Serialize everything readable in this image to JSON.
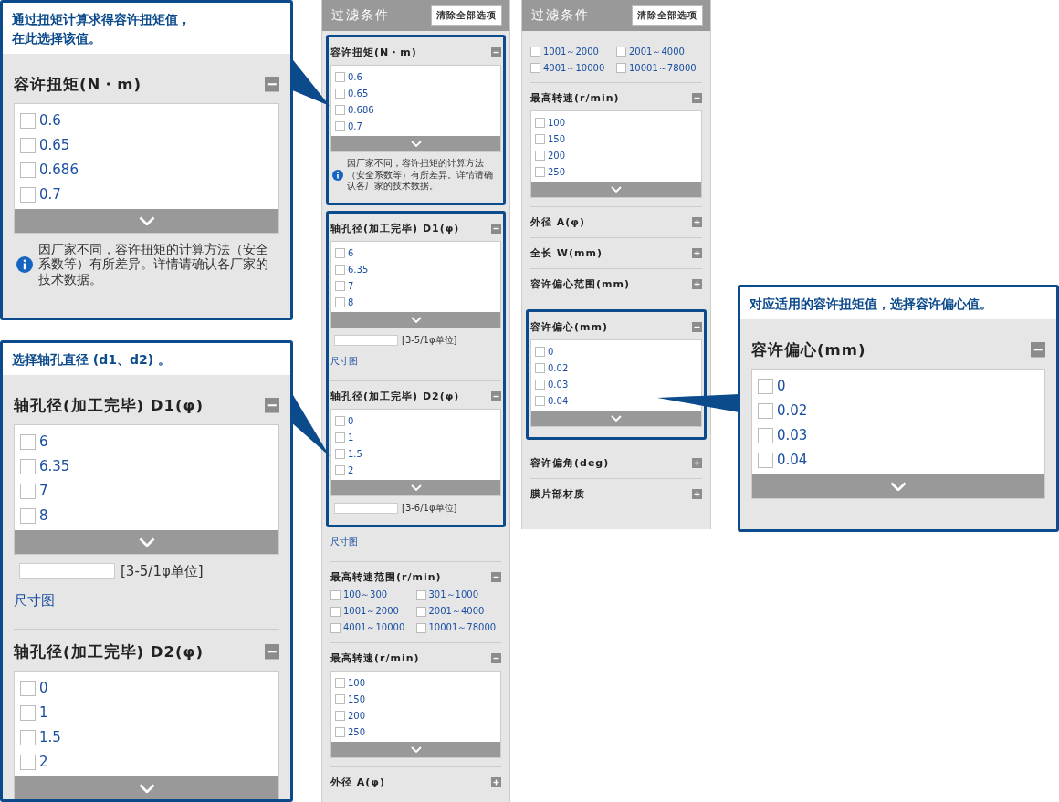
{
  "callouts": [
    {
      "caption": [
        "通过扭矩计算求得容许扭矩值，",
        "在此选择该值。"
      ],
      "groups": [
        {
          "sections": [
            {
              "kind": "list",
              "title": "容许扭矩(N・m)",
              "expanded": true,
              "items": [
                {
                  "label": "0.6",
                  "checked": false
                },
                {
                  "label": "0.65",
                  "checked": false
                },
                {
                  "label": "0.686",
                  "checked": false
                },
                {
                  "label": "0.7",
                  "checked": false
                }
              ],
              "note": "因厂家不同，容许扭矩的计算方法（安全系数等）有所差异。详情请确认各厂家的技术数据。"
            }
          ]
        }
      ]
    },
    {
      "caption": [
        "选择轴孔直径 (d1、d2) 。"
      ],
      "groups": [
        {
          "sections": [
            {
              "kind": "list",
              "title": "轴孔径(加工完毕) D1(φ)",
              "expanded": true,
              "items": [
                {
                  "label": "6",
                  "checked": false
                },
                {
                  "label": "6.35",
                  "checked": false
                },
                {
                  "label": "7",
                  "checked": false
                },
                {
                  "label": "8",
                  "checked": false
                }
              ],
              "range": "[3-5/1φ单位]"
            },
            {
              "kind": "link",
              "label": "尺寸图"
            },
            {
              "kind": "list",
              "title": "轴孔径(加工完毕) D2(φ)",
              "expanded": true,
              "items": [
                {
                  "label": "0",
                  "checked": false
                },
                {
                  "label": "1",
                  "checked": false
                },
                {
                  "label": "1.5",
                  "checked": false
                },
                {
                  "label": "2",
                  "checked": false
                }
              ]
            }
          ]
        }
      ]
    },
    {
      "caption": [
        "对应适用的容许扭矩值，选择容许偏心值。"
      ],
      "groups": [
        {
          "sections": [
            {
              "kind": "list",
              "title": "容许偏心(mm)",
              "expanded": true,
              "items": [
                {
                  "label": "0",
                  "checked": false
                },
                {
                  "label": "0.02",
                  "checked": false
                },
                {
                  "label": "0.03",
                  "checked": false
                },
                {
                  "label": "0.04",
                  "checked": false
                }
              ]
            }
          ]
        }
      ]
    }
  ],
  "panels": [
    {
      "title": "过滤条件",
      "clear_button": "清除全部选项",
      "groups": [
        {
          "highlighted": true,
          "sections": [
            {
              "kind": "list",
              "title": "容许扭矩(N・m)",
              "expanded": true,
              "items": [
                {
                  "label": "0.6",
                  "checked": false
                },
                {
                  "label": "0.65",
                  "checked": false
                },
                {
                  "label": "0.686",
                  "checked": false
                },
                {
                  "label": "0.7",
                  "checked": false
                }
              ],
              "note": "因厂家不同，容许扭矩的计算方法（安全系数等）有所差异。详情请确认各厂家的技术数据。"
            }
          ]
        },
        {
          "highlighted": true,
          "sections": [
            {
              "kind": "list",
              "title": "轴孔径(加工完毕) D1(φ)",
              "expanded": true,
              "items": [
                {
                  "label": "6",
                  "checked": false
                },
                {
                  "label": "6.35",
                  "checked": false
                },
                {
                  "label": "7",
                  "checked": false
                },
                {
                  "label": "8",
                  "checked": false
                }
              ],
              "range": "[3-5/1φ单位]"
            },
            {
              "kind": "link",
              "label": "尺寸图"
            },
            {
              "kind": "list",
              "title": "轴孔径(加工完毕) D2(φ)",
              "expanded": true,
              "items": [
                {
                  "label": "0",
                  "checked": false
                },
                {
                  "label": "1",
                  "checked": false
                },
                {
                  "label": "1.5",
                  "checked": false
                },
                {
                  "label": "2",
                  "checked": false
                }
              ],
              "range": "[3-6/1φ单位]"
            }
          ]
        },
        {
          "highlighted": false,
          "sections": [
            {
              "kind": "link",
              "label": "尺寸图"
            },
            {
              "kind": "grid",
              "title": "最高转速范围(r/min)",
              "expanded": true,
              "items": [
                {
                  "label": "100～300",
                  "checked": false
                },
                {
                  "label": "301～1000",
                  "checked": false
                },
                {
                  "label": "1001～2000",
                  "checked": false
                },
                {
                  "label": "2001～4000",
                  "checked": false
                },
                {
                  "label": "4001～10000",
                  "checked": false
                },
                {
                  "label": "10001～78000",
                  "checked": false
                }
              ]
            },
            {
              "kind": "list",
              "title": "最高转速(r/min)",
              "expanded": true,
              "items": [
                {
                  "label": "100",
                  "checked": false
                },
                {
                  "label": "150",
                  "checked": false
                },
                {
                  "label": "200",
                  "checked": false
                },
                {
                  "label": "250",
                  "checked": false
                }
              ]
            },
            {
              "kind": "list",
              "title": "外径 A(φ)",
              "expanded": false
            }
          ]
        }
      ]
    },
    {
      "title": "过滤条件",
      "clear_button": "清除全部选项",
      "groups": [
        {
          "highlighted": false,
          "sections": [
            {
              "kind": "grid",
              "items": [
                {
                  "label": "1001～2000",
                  "checked": false
                },
                {
                  "label": "2001～4000",
                  "checked": false
                },
                {
                  "label": "4001～10000",
                  "checked": false
                },
                {
                  "label": "10001～78000",
                  "checked": false
                }
              ]
            },
            {
              "kind": "list",
              "title": "最高转速(r/min)",
              "expanded": true,
              "items": [
                {
                  "label": "100",
                  "checked": false
                },
                {
                  "label": "150",
                  "checked": false
                },
                {
                  "label": "200",
                  "checked": false
                },
                {
                  "label": "250",
                  "checked": false
                }
              ]
            },
            {
              "kind": "list",
              "title": "外径 A(φ)",
              "expanded": false
            },
            {
              "kind": "list",
              "title": "全长 W(mm)",
              "expanded": false
            },
            {
              "kind": "list",
              "title": "容许偏心范围(mm)",
              "expanded": false
            }
          ]
        },
        {
          "highlighted": true,
          "sections": [
            {
              "kind": "list",
              "title": "容许偏心(mm)",
              "expanded": true,
              "items": [
                {
                  "label": "0",
                  "checked": false
                },
                {
                  "label": "0.02",
                  "checked": false
                },
                {
                  "label": "0.03",
                  "checked": false
                },
                {
                  "label": "0.04",
                  "checked": false
                }
              ]
            }
          ]
        },
        {
          "highlighted": false,
          "sections": [
            {
              "kind": "list",
              "title": "容许偏角(deg)",
              "expanded": false
            },
            {
              "kind": "list",
              "title": "膜片部材质",
              "expanded": false
            }
          ]
        }
      ]
    }
  ]
}
